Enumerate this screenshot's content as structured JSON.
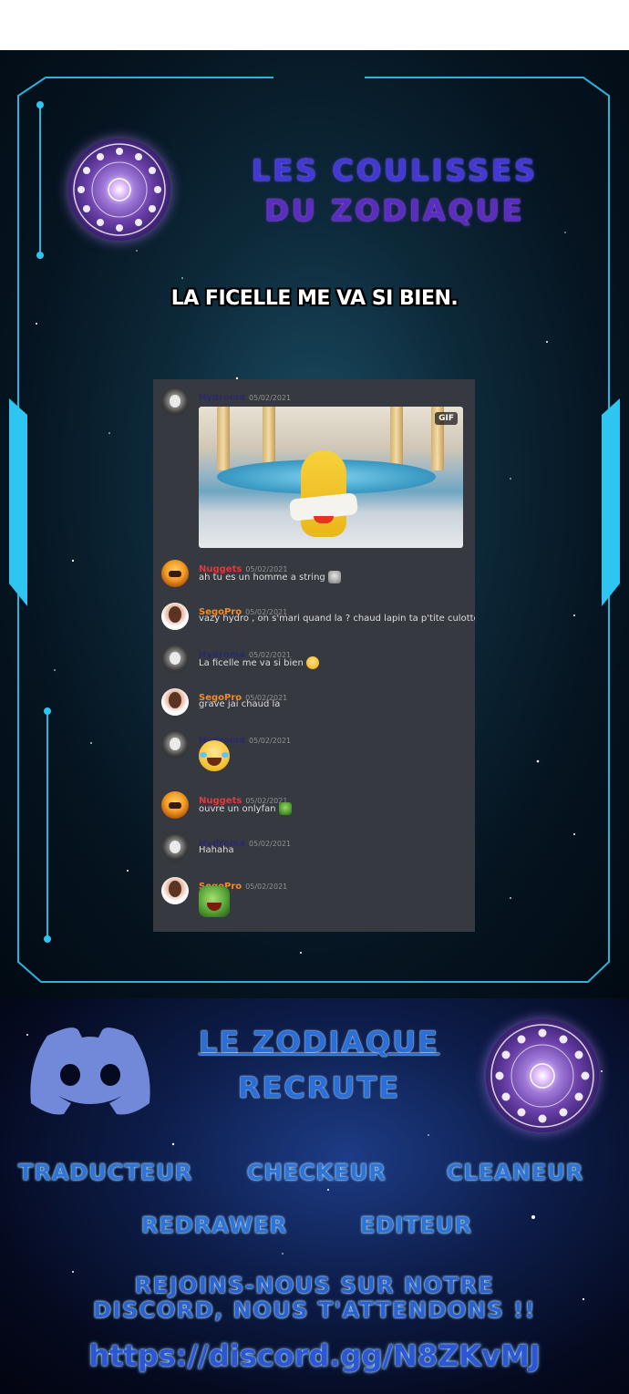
{
  "header": {
    "title_line1": "LES COULISSES",
    "title_line2": "DU ZODIAQUE"
  },
  "caption": "LA FICELLE ME VA SI BIEN.",
  "chat": {
    "messages": [
      {
        "author": "Hydroma",
        "time": "05/02/2021",
        "text": "",
        "attachment": "GIF"
      },
      {
        "author": "Nuggets",
        "time": "05/02/2021",
        "text": "ah tu es un homme a string"
      },
      {
        "author": "SegoPro",
        "time": "05/02/2021",
        "text": "vazy hydro , on s'mari quand la ? chaud lapin ta p'tite culotte"
      },
      {
        "author": "Hydroma",
        "time": "05/02/2021",
        "text": "La ficelle me va si bien"
      },
      {
        "author": "SegoPro",
        "time": "05/02/2021",
        "text": "grave jai chaud la"
      },
      {
        "author": "Hydroma",
        "time": "05/02/2021",
        "text": ""
      },
      {
        "author": "Nuggets",
        "time": "05/02/2021",
        "text": "ouvre un onlyfan"
      },
      {
        "author": "Hydroma",
        "time": "05/02/2021",
        "text": "Hahaha"
      },
      {
        "author": "SegoPro",
        "time": "05/02/2021",
        "text": ""
      }
    ]
  },
  "recruit": {
    "line1": "LE ZODIAQUE",
    "line2": "RECRUTE",
    "roles": [
      "TRADUCTEUR",
      "CHECKEUR",
      "CLEANEUR",
      "REDRAWER",
      "EDITEUR"
    ],
    "join_line1": "REJOINS-NOUS SUR NOTRE",
    "join_line2": "DISCORD, NOUS T'ATTENDONS !!",
    "link": "https://discord.gg/N8ZKvMJ"
  },
  "icons": [
    "zodiac-wheel-icon",
    "discord-logo-icon",
    "laughing-emoji-icon",
    "pepe-emoji-icon",
    "moai-emoji-icon"
  ],
  "colors": {
    "chat_bg": "#36393f",
    "discord_blurple": "#7289da",
    "title_blue": "#4536d6",
    "title_purple": "#5a2cc2"
  }
}
